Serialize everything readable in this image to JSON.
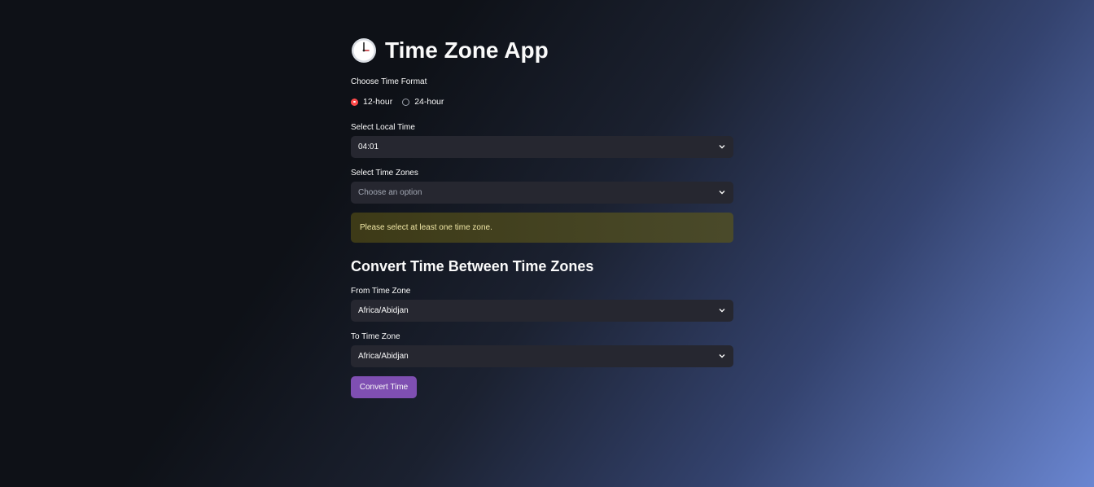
{
  "app": {
    "title": "Time Zone App",
    "title_icon": "clock-icon"
  },
  "time_format": {
    "label": "Choose Time Format",
    "options": [
      "12-hour",
      "24-hour"
    ],
    "selected": "12-hour"
  },
  "local_time": {
    "label": "Select Local Time",
    "value": "04:01"
  },
  "time_zones": {
    "label": "Select Time Zones",
    "placeholder": "Choose an option"
  },
  "warning": {
    "text": "Please select at least one time zone."
  },
  "convert": {
    "heading": "Convert Time Between Time Zones",
    "from_label": "From Time Zone",
    "from_value": "Africa/Abidjan",
    "to_label": "To Time Zone",
    "to_value": "Africa/Abidjan",
    "button_label": "Convert Time"
  },
  "colors": {
    "accent": "#ff4b4b",
    "button": "#7f4fb2",
    "input_bg": "#262730",
    "warning_bg": "#3d3a17"
  }
}
